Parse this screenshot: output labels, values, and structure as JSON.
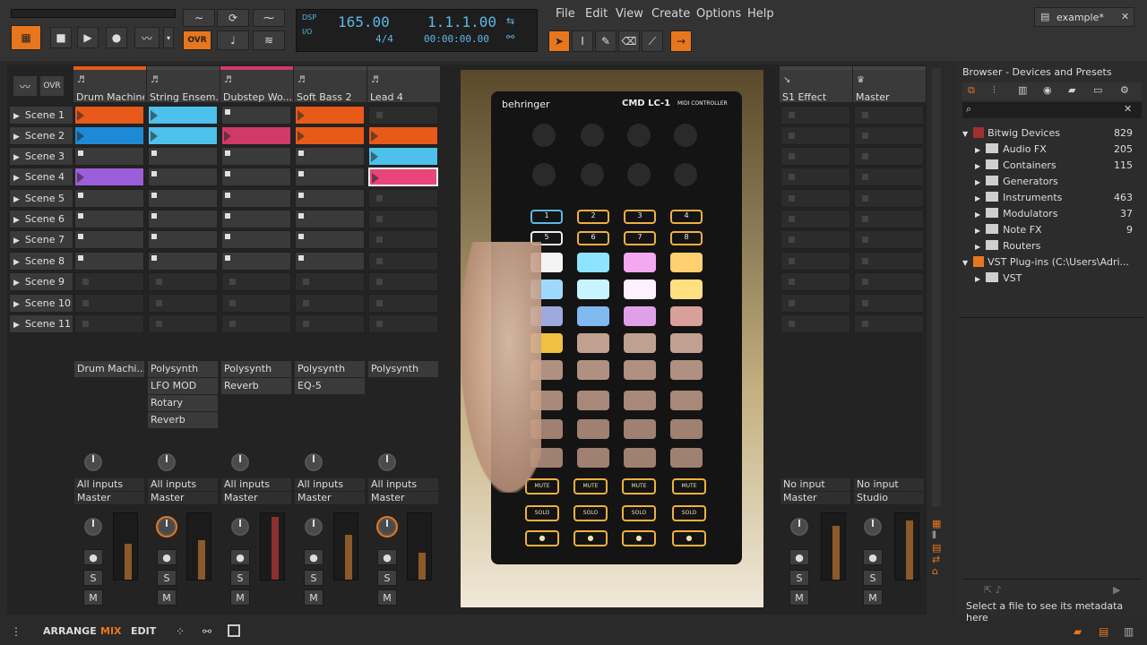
{
  "topbar": {
    "dsp": "DSP",
    "io": "I/O",
    "tempo": "165.00",
    "timesig": "4/4",
    "position": "1.1.1.00",
    "time": "00:00:00.00",
    "ovr": "OVR",
    "menu": [
      "File",
      "Edit",
      "View",
      "Create",
      "Options",
      "Help"
    ],
    "doc_tab": "example*"
  },
  "tracks": [
    {
      "name": "Drum Machine",
      "color": "#e85a1a"
    },
    {
      "name": "String Ensem...",
      "color": "#3a3a3a"
    },
    {
      "name": "Dubstep Wo...",
      "color": "#d03a6a"
    },
    {
      "name": "Soft Bass 2",
      "color": "#3a3a3a"
    },
    {
      "name": "Lead 4",
      "color": "#3a3a3a"
    }
  ],
  "fx_tracks": [
    {
      "name": "S1 Effect"
    },
    {
      "name": "Master"
    }
  ],
  "scenes": [
    "Scene 1",
    "Scene 2",
    "Scene 3",
    "Scene 4",
    "Scene 5",
    "Scene 6",
    "Scene 7",
    "Scene 8",
    "Scene 9",
    "Scene 10",
    "Scene 11"
  ],
  "devices": [
    [
      "Drum Machi..."
    ],
    [
      "Polysynth",
      "LFO MOD",
      "Rotary",
      "Reverb"
    ],
    [
      "Polysynth",
      "Reverb"
    ],
    [
      "Polysynth",
      "EQ-5"
    ],
    [
      "Polysynth"
    ]
  ],
  "inputs": [
    "All inputs",
    "All inputs",
    "All inputs",
    "All inputs",
    "All inputs",
    "No input",
    "No input"
  ],
  "outputs": [
    "Master",
    "Master",
    "Master",
    "Master",
    "Master",
    "Master",
    "Studio"
  ],
  "buttons": {
    "solo": "S",
    "mute": "M",
    "ovr": "OVR",
    "w": "W"
  },
  "browser": {
    "title": "Browser - Devices and Presets",
    "root1": "Bitwig Devices",
    "root1_count": "829",
    "items": [
      {
        "label": "Audio FX",
        "count": "205"
      },
      {
        "label": "Containers",
        "count": "115"
      },
      {
        "label": "Generators",
        "count": ""
      },
      {
        "label": "Instruments",
        "count": "463"
      },
      {
        "label": "Modulators",
        "count": "37"
      },
      {
        "label": "Note FX",
        "count": "9"
      },
      {
        "label": "Routers",
        "count": ""
      }
    ],
    "root2": "VST Plug-ins (C:\\Users\\Adri...",
    "vst": "VST",
    "status": "Select a file to see its metadata here"
  },
  "controller": {
    "brand": "behringer",
    "model": "CMD LC-1",
    "sub": "MIDI CONTROLLER",
    "top_labels": [
      "1",
      "2",
      "3",
      "4",
      "5",
      "6",
      "7",
      "8"
    ],
    "mute": "MUTE",
    "solo": "SOLO"
  },
  "bottom": {
    "arrange": "ARRANGE",
    "mix": "MIX",
    "edit": "EDIT"
  },
  "colors": {
    "accent": "#e8761d",
    "blue": "#5cb8e6"
  }
}
